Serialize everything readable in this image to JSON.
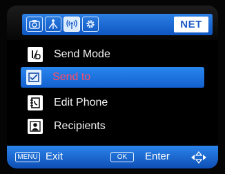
{
  "tabs": [
    {
      "icon": "camera-icon",
      "active": false
    },
    {
      "icon": "network-icon",
      "active": false
    },
    {
      "icon": "wireless-icon",
      "active": true
    },
    {
      "icon": "gear-icon",
      "active": false
    }
  ],
  "header": {
    "badge": "NET"
  },
  "menu": {
    "items": [
      {
        "label": "Send Mode",
        "icon": "send-mode-icon",
        "selected": false
      },
      {
        "label": "Send to",
        "icon": "send-to-icon",
        "selected": true
      },
      {
        "label": "Edit Phone",
        "icon": "phone-book-icon",
        "selected": false
      },
      {
        "label": "Recipients",
        "icon": "recipient-icon",
        "selected": false
      }
    ]
  },
  "footer": {
    "menu_key": "MENU",
    "exit_label": "Exit",
    "ok_key": "OK",
    "enter_label": "Enter"
  },
  "colors": {
    "accent": "#1a6fe0",
    "selected_text": "#ff4d66",
    "text": "#f2f2f2"
  }
}
